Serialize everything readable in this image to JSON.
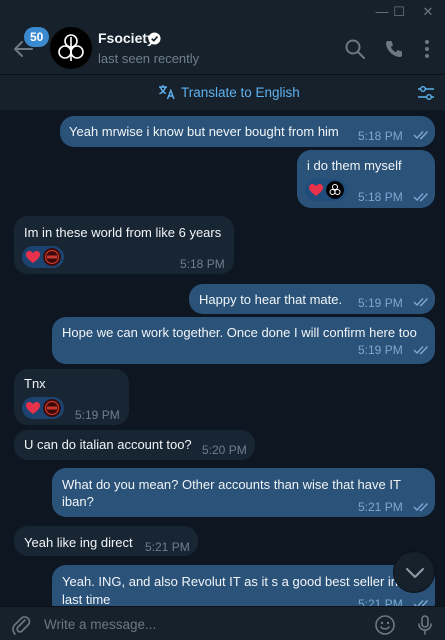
{
  "window": {
    "minimize": "—",
    "maximize": "☐",
    "close": "✕"
  },
  "header": {
    "unread_count": "50",
    "chat_name": "Fsociety",
    "status": "last seen recently"
  },
  "translate": {
    "label": "Translate to English"
  },
  "messages": [
    {
      "side": "out",
      "text": "Yeah mrwise i know but never bought from him",
      "time": "5:18 PM",
      "read": true
    },
    {
      "side": "out",
      "text": "i do them myself",
      "time": "5:18 PM",
      "read": true,
      "reactions": [
        "heart",
        "fsociety-avatar"
      ]
    },
    {
      "side": "in",
      "text": "Im in these world from like 6 years",
      "time": "5:18 PM",
      "reactions": [
        "heart",
        "user-avatar"
      ]
    },
    {
      "side": "out",
      "text": "Happy to hear that mate.",
      "time": "5:19 PM",
      "read": true
    },
    {
      "side": "out",
      "text": "Hope we can work together. Once done I will confirm here too",
      "time": "5:19 PM",
      "read": true
    },
    {
      "side": "in",
      "text": "Tnx",
      "time": "5:19 PM",
      "reactions": [
        "heart",
        "user-avatar"
      ]
    },
    {
      "side": "in",
      "text": "U can do italian account too?",
      "time": "5:20 PM"
    },
    {
      "side": "out",
      "lines": [
        "What do you mean? Other accounts than wise that have IT",
        "iban?"
      ],
      "time": "5:21 PM",
      "read": true
    },
    {
      "side": "in",
      "text": "Yeah like ing direct",
      "time": "5:21 PM"
    },
    {
      "side": "out",
      "lines": [
        "Yeah. ING, and also Revolut IT as it s a good best seller in th",
        "last time"
      ],
      "time": "5:21 PM",
      "read": true
    }
  ],
  "composer": {
    "placeholder": "Write a message..."
  },
  "colors": {
    "accent": "#5fb2ef",
    "outgoing": "#2b5278",
    "incoming": "#182533",
    "background": "#0e1621"
  }
}
